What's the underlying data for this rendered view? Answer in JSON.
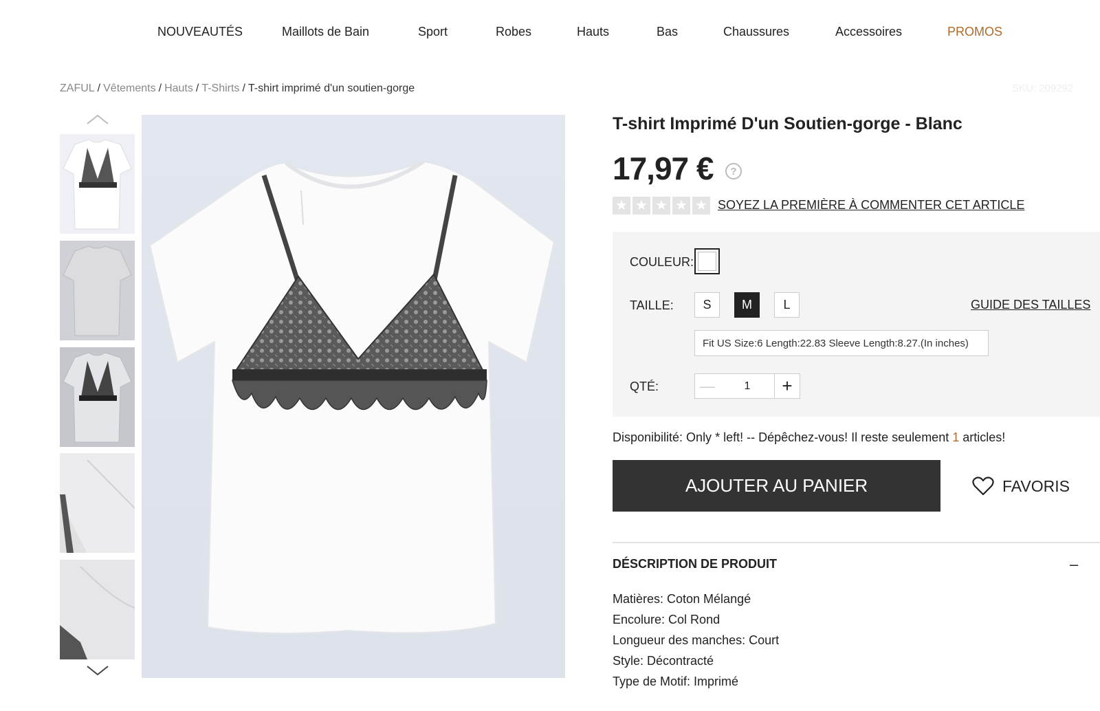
{
  "nav": {
    "items": [
      "NOUVEAUTÉS",
      "Maillots de Bain",
      "Sport",
      "Robes",
      "Hauts",
      "Bas",
      "Chaussures",
      "Accessoires",
      "PROMOS"
    ]
  },
  "breadcrumb": {
    "items": [
      "ZAFUL",
      "Vêtements",
      "Hauts",
      "T-Shirts"
    ],
    "current": "T-shirt imprimé d'un soutien-gorge",
    "separator": "/"
  },
  "sku": "SKU: 209292",
  "product": {
    "title": "T-shirt Imprimé D'un Soutien-gorge - Blanc",
    "price": "17,97 €",
    "help_icon": "?",
    "rating_stars": 5,
    "review_link": "SOYEZ LA PREMIÈRE À COMMENTER CET ARTICLE",
    "color_label": "COULEUR:",
    "size_label": "TAILLE:",
    "sizes": [
      "S",
      "M",
      "L"
    ],
    "selected_size": "M",
    "size_guide": "GUIDE DES TAILLES",
    "fit_info": "Fit US Size:6   Length:22.83   Sleeve Length:8.27.(In inches)",
    "qty_label": "QTÉ:",
    "qty_value": "1",
    "availability_prefix": "Disponibilité: Only * left! -- Dépêchez-vous! Il reste seulement ",
    "availability_count": "1",
    "availability_suffix": " articles!",
    "add_to_cart": "AJOUTER AU PANIER",
    "favorites": "FAVORIS"
  },
  "description": {
    "heading": "DÉSCRIPTION DE PRODUIT",
    "toggle": "–",
    "lines": [
      "Matières: Coton Mélangé",
      "Encolure: Col Rond",
      "Longueur des manches: Court",
      "Style: Décontracté",
      "Type de Motif: Imprimé"
    ]
  },
  "colors": {
    "promo": "#b06a2a",
    "button_dark": "#333333",
    "options_bg": "#f4f4f4"
  },
  "icons": {
    "thumb_prev": "chevron-up-icon",
    "thumb_next": "chevron-down-icon",
    "favorite": "heart-icon",
    "help": "question-circle-icon",
    "star": "star-icon"
  }
}
